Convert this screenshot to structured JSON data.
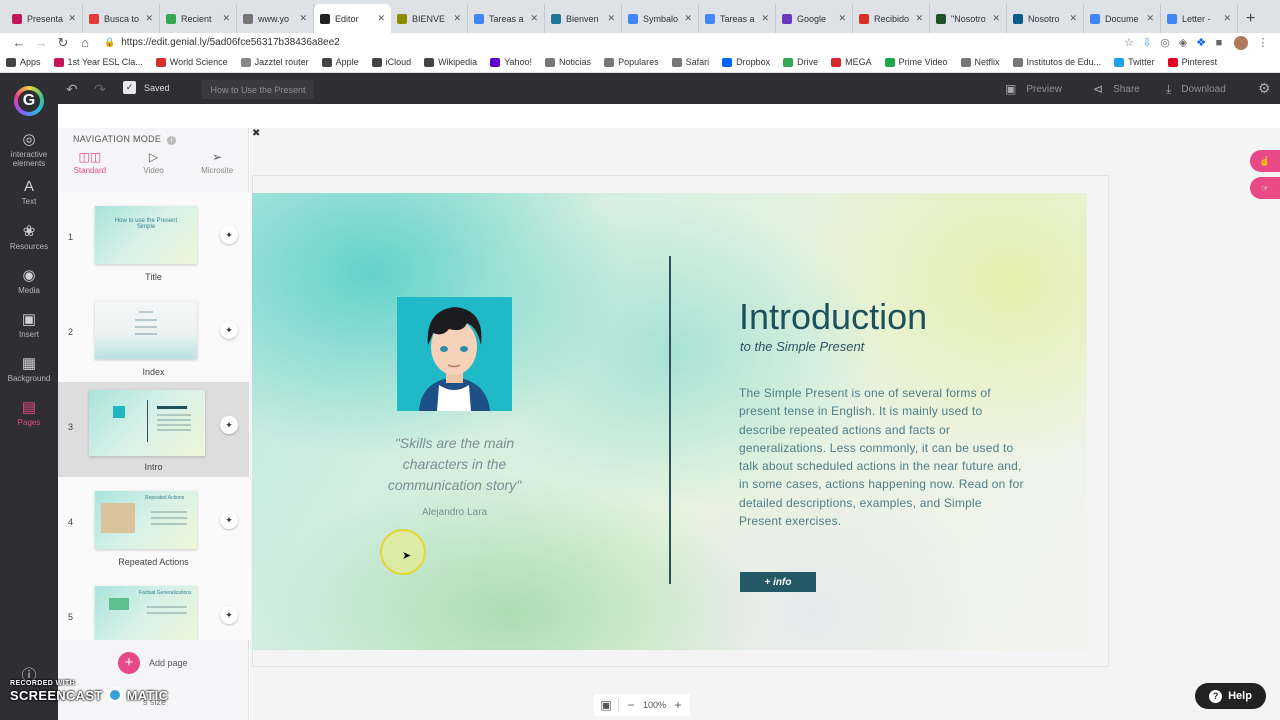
{
  "browser": {
    "tabs": [
      {
        "label": "Presenta",
        "color": "#c2185b"
      },
      {
        "label": "Busca to",
        "color": "#e53935"
      },
      {
        "label": "Recient",
        "color": "#34a853"
      },
      {
        "label": "www.yo",
        "color": "#777777"
      },
      {
        "label": "Editor",
        "color": "#222222",
        "active": true
      },
      {
        "label": "BIENVE",
        "color": "#8d8d00"
      },
      {
        "label": "Tareas a",
        "color": "#4285f4"
      },
      {
        "label": "Bienven",
        "color": "#21759b"
      },
      {
        "label": "Symbalo",
        "color": "#4285f4"
      },
      {
        "label": "Tareas a",
        "color": "#4285f4"
      },
      {
        "label": "Google",
        "color": "#673ab7"
      },
      {
        "label": "Recibido",
        "color": "#d93025"
      },
      {
        "label": "\"Nosotro",
        "color": "#1e5128"
      },
      {
        "label": "Nosotro",
        "color": "#0a5a8a"
      },
      {
        "label": "Docume",
        "color": "#4285f4"
      },
      {
        "label": "Letter -",
        "color": "#4285f4"
      }
    ],
    "url": "https://edit.genial.ly/5ad06fce56317b38436a8ee2",
    "bookmarks": [
      {
        "label": "Apps",
        "color": "#444444"
      },
      {
        "label": "1st Year ESL Cla...",
        "color": "#c2185b"
      },
      {
        "label": "World Science",
        "color": "#d32f2f"
      },
      {
        "label": "Jazztel router",
        "color": "#888888"
      },
      {
        "label": "Apple",
        "color": "#444444"
      },
      {
        "label": "iCloud",
        "color": "#444444"
      },
      {
        "label": "Wikipedia",
        "color": "#444444"
      },
      {
        "label": "Yahoo!",
        "color": "#5f01d1"
      },
      {
        "label": "Noticias",
        "color": "#777777"
      },
      {
        "label": "Populares",
        "color": "#777777"
      },
      {
        "label": "Safari",
        "color": "#777777"
      },
      {
        "label": "Dropbox",
        "color": "#0061ff"
      },
      {
        "label": "Drive",
        "color": "#34a853"
      },
      {
        "label": "MEGA",
        "color": "#d9272e"
      },
      {
        "label": "Prime Video",
        "color": "#1ea84a"
      },
      {
        "label": "Netflix",
        "color": "#777777"
      },
      {
        "label": "Institutos de Edu...",
        "color": "#777777"
      },
      {
        "label": "Twitter",
        "color": "#1da1f2"
      },
      {
        "label": "Pinterest",
        "color": "#e60023"
      }
    ]
  },
  "editor": {
    "saved_label": "Saved",
    "doc_title": "How to Use the Present",
    "preview_label": "Preview",
    "share_label": "Share",
    "download_label": "Download",
    "accent_color": "#e84a88"
  },
  "leftnav": {
    "items": [
      {
        "label": "Interactive elements",
        "icon": "interactive-icon"
      },
      {
        "label": "Text",
        "icon": "text-icon"
      },
      {
        "label": "Resources",
        "icon": "resources-icon"
      },
      {
        "label": "Media",
        "icon": "camera-icon"
      },
      {
        "label": "Insert",
        "icon": "insert-icon"
      },
      {
        "label": "Background",
        "icon": "background-icon"
      },
      {
        "label": "Pages",
        "icon": "pages-icon",
        "active": true
      }
    ]
  },
  "panel": {
    "nav_mode_label": "NAVIGATION MODE",
    "modes": [
      {
        "label": "Standard",
        "active": true
      },
      {
        "label": "Video"
      },
      {
        "label": "Microsite"
      }
    ],
    "pages": [
      {
        "num": "1",
        "label": "Title",
        "thumb_text": "How to use the Present Simple"
      },
      {
        "num": "2",
        "label": "Index",
        "thumb_text": ""
      },
      {
        "num": "3",
        "label": "Intro",
        "thumb_text": "",
        "active": true
      },
      {
        "num": "4",
        "label": "Repeated Actions",
        "thumb_text": "Repeated Actions"
      },
      {
        "num": "5",
        "label": "",
        "thumb_text": "Factual Generalizations"
      }
    ],
    "add_page_label": "Add page"
  },
  "slide": {
    "quote": "\"Skills are the main characters in the communication story\"",
    "author": "Alejandro Lara",
    "title": "Introduction",
    "subtitle": "to the Simple Present",
    "body": "The Simple Present is one of several forms of present tense in English. It is mainly used to describe repeated actions and facts or generalizations. Less commonly, it can be used to talk about scheduled actions in the near future and, in some cases, actions happening now. Read on for detailed descriptions, examples, and Simple Present exercises.",
    "info_button": "+ info"
  },
  "bottom": {
    "zoom": "100%",
    "help_label": "Help",
    "block_size_label": "s size"
  },
  "watermark": {
    "line1": "RECORDED WITH",
    "line2a": "SCREENCAST",
    "line2b": "MATIC"
  }
}
